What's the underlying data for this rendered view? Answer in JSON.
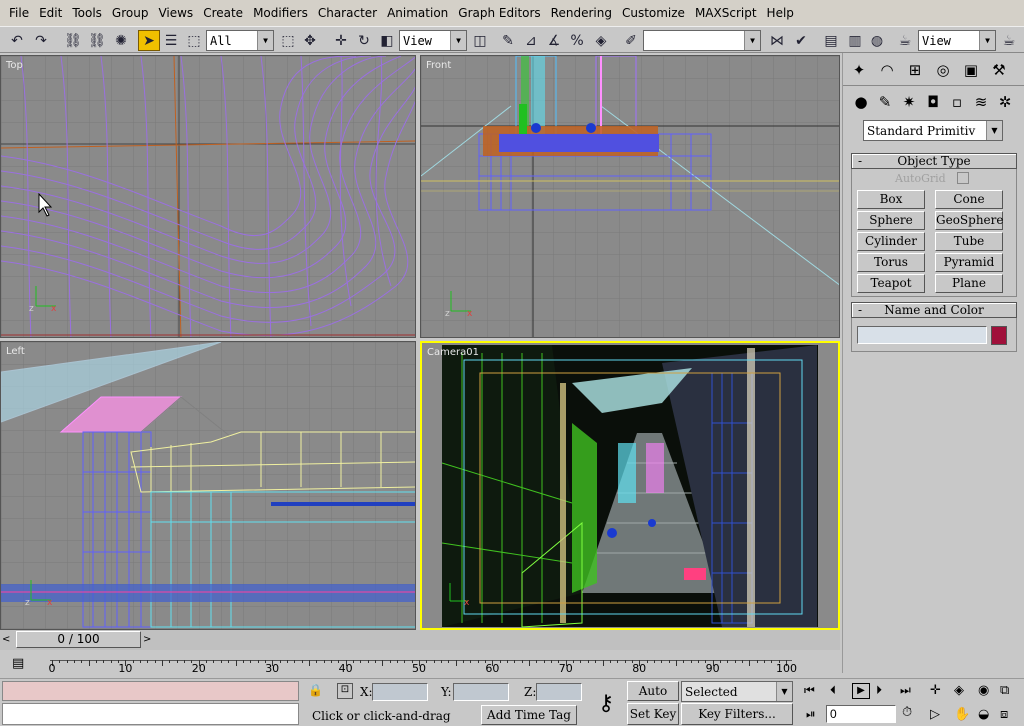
{
  "menu": [
    "File",
    "Edit",
    "Tools",
    "Group",
    "Views",
    "Create",
    "Modifiers",
    "Character",
    "Animation",
    "Graph Editors",
    "Rendering",
    "Customize",
    "MAXScript",
    "Help"
  ],
  "toolbar": {
    "selection_filter": "All",
    "ref_coord_1": "View",
    "named_selection": "",
    "ref_coord_2": "View"
  },
  "viewports": {
    "top": "Top",
    "front": "Front",
    "left": "Left",
    "camera": "Camera01"
  },
  "command_panel": {
    "category_dropdown": "Standard Primitiv",
    "object_type": {
      "title": "Object Type",
      "autogrid": "AutoGrid",
      "buttons": [
        "Box",
        "Cone",
        "Sphere",
        "GeoSphere",
        "Cylinder",
        "Tube",
        "Torus",
        "Pyramid",
        "Teapot",
        "Plane"
      ]
    },
    "name_and_color": {
      "title": "Name and Color",
      "name_value": "",
      "color": "#a0103a"
    }
  },
  "timeline": {
    "frame_counter": "0 / 100",
    "ticks": [
      "0",
      "10",
      "20",
      "30",
      "40",
      "50",
      "60",
      "70",
      "80",
      "90",
      "100"
    ]
  },
  "status": {
    "x_label": "X:",
    "y_label": "Y:",
    "z_label": "Z:",
    "prompt": "Click or click-and-drag",
    "add_time_tag": "Add Time Tag",
    "auto_key": "Auto Key",
    "set_key": "Set Key",
    "selected": "Selected",
    "key_filters": "Key Filters...",
    "current_frame": "0"
  },
  "colors": {
    "active_viewport_border": "#ffff00",
    "active_tool": "#f0c000",
    "wire_purple": "#9a70e0"
  }
}
